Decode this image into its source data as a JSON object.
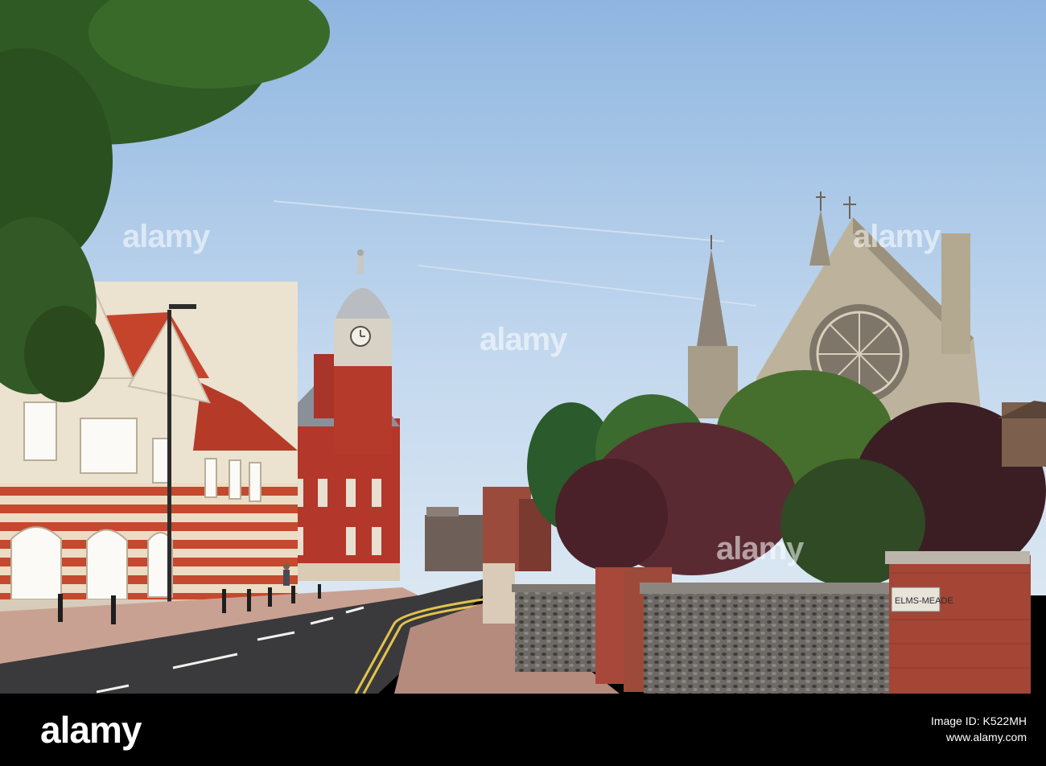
{
  "photo": {
    "scene": "street-with-town-hall-and-church",
    "sky_color": "#b9d3ec",
    "brick_color": "#b3372a",
    "stone_color": "#e8e0cc",
    "road_color": "#3a3a3c"
  },
  "street_sign": {
    "text": "ELMS-MEADE"
  },
  "watermark": {
    "text": "alamy"
  },
  "footer": {
    "brand": "alamy",
    "image_id_label": "Image ID: K522MH",
    "url": "www.alamy.com"
  }
}
